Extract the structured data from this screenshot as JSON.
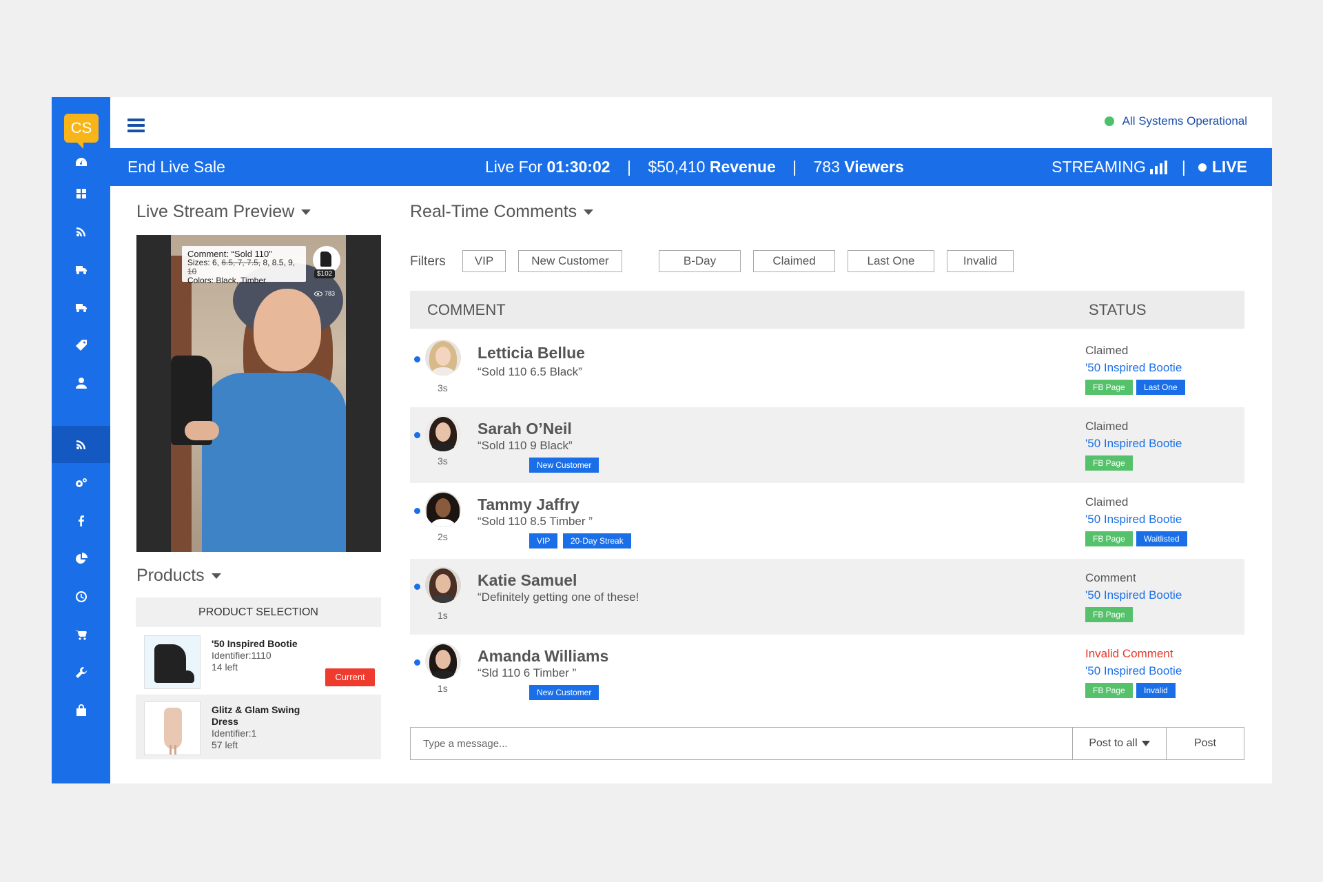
{
  "app": {
    "logo_text": "CS",
    "system_status": "All Systems Operational",
    "colors": {
      "primary": "#1a6fe8",
      "accent": "#f7b519",
      "success": "#4cc16a",
      "danger": "#ef3b2d"
    }
  },
  "sidebar": {
    "items": [
      {
        "icon": "dashboard-icon"
      },
      {
        "icon": "grid-icon"
      },
      {
        "icon": "rss-icon"
      },
      {
        "icon": "truck-icon"
      },
      {
        "icon": "truck-icon"
      },
      {
        "icon": "tag-icon"
      },
      {
        "icon": "user-icon"
      },
      {
        "icon": "rss-icon",
        "active": true
      },
      {
        "icon": "gears-icon"
      },
      {
        "icon": "facebook-icon"
      },
      {
        "icon": "pie-chart-icon"
      },
      {
        "icon": "clock-icon"
      },
      {
        "icon": "cart-icon"
      },
      {
        "icon": "wrench-icon"
      },
      {
        "icon": "bag-icon"
      }
    ]
  },
  "livebar": {
    "end_label": "End Live Sale",
    "live_for_label": "Live For",
    "live_for_value": "01:30:02",
    "revenue_value": "$50,410",
    "revenue_label": "Revenue",
    "viewers_value": "783",
    "viewers_label": "Viewers",
    "streaming_label": "STREAMING",
    "live_label": "LIVE",
    "separator": "|"
  },
  "preview": {
    "title": "Live Stream Preview",
    "overlay_comment": "Comment: “Sold 110”",
    "overlay_sizes_prefix": "Sizes: 6,",
    "overlay_sizes_struck_1": "6.5, 7, 7.5,",
    "overlay_sizes_mid": "8, 8.5, 9,",
    "overlay_sizes_struck_2": "10",
    "overlay_colors": "Colors: Black, Timber",
    "price": "$102",
    "viewers": "783"
  },
  "products": {
    "title": "Products",
    "header": "PRODUCT SELECTION",
    "items": [
      {
        "name": "'50 Inspired Bootie",
        "identifier": "Identifier:1110",
        "stock": "14 left",
        "badge": "Current"
      },
      {
        "name": "Glitz & Glam Swing Dress",
        "identifier": "Identifier:1",
        "stock": "57 left"
      }
    ]
  },
  "comments": {
    "title": "Real-Time Comments",
    "filters_label": "Filters",
    "filters": [
      "VIP",
      "New Customer",
      "B-Day",
      "Claimed",
      "Last One",
      "Invalid"
    ],
    "col_comment": "COMMENT",
    "col_status": "STATUS",
    "rows": [
      {
        "name": "Letticia Bellue",
        "text": "“Sold 110 6.5 Black”",
        "ago": "3s",
        "tags": [],
        "status": "Claimed",
        "product": "'50 Inspired Bootie",
        "status_tags": [
          "FB Page",
          "Last One"
        ]
      },
      {
        "name": "Sarah O’Neil",
        "text": "“Sold 110 9 Black”",
        "ago": "3s",
        "tags": [
          "New Customer"
        ],
        "status": "Claimed",
        "product": "'50 Inspired Bootie",
        "status_tags": [
          "FB Page"
        ]
      },
      {
        "name": "Tammy Jaffry",
        "text": "“Sold 110 8.5 Timber ”",
        "ago": "2s",
        "tags": [
          "VIP",
          "20-Day Streak"
        ],
        "status": "Claimed",
        "product": "'50 Inspired Bootie",
        "status_tags": [
          "FB Page",
          "Waitlisted"
        ]
      },
      {
        "name": "Katie Samuel",
        "text": "“Definitely getting one of these!",
        "ago": "1s",
        "tags": [],
        "status": "Comment",
        "product": "'50 Inspired Bootie",
        "status_tags": [
          "FB Page"
        ]
      },
      {
        "name": "Amanda Williams",
        "text": "“Sld 110 6 Timber ”",
        "ago": "1s",
        "tags": [
          "New Customer"
        ],
        "status": "Invalid Comment",
        "product": "'50 Inspired Bootie",
        "status_tags": [
          "FB Page",
          "Invalid"
        ]
      }
    ]
  },
  "composer": {
    "placeholder": "Type a message...",
    "post_to_label": "Post to all",
    "post_label": "Post"
  }
}
